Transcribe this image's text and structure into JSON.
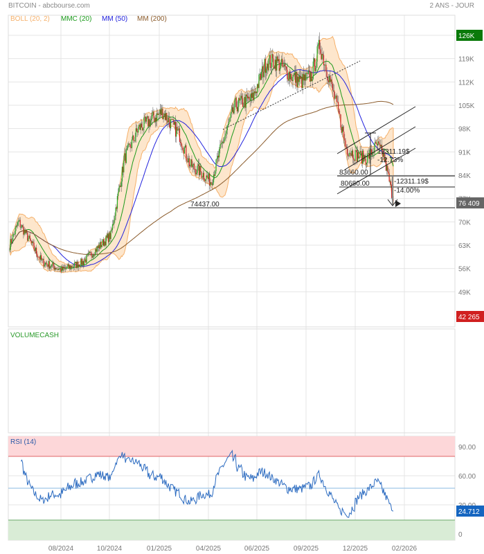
{
  "header": {
    "title": "BITCOIN - abcbourse.com",
    "period": "2 ANS - JOUR"
  },
  "legend": [
    {
      "label": "BOLL (20, 2)",
      "color": "#f5b06a"
    },
    {
      "label": "MMC (20)",
      "color": "#1a9a1a"
    },
    {
      "label": "MM (50)",
      "color": "#2222dd"
    },
    {
      "label": "MM (200)",
      "color": "#8a5a2a"
    }
  ],
  "price_tags": {
    "high": "126K",
    "last": "76 409",
    "low": "42 265",
    "rsi_last": "24.712"
  },
  "volume_label": "VOLUMECASH",
  "rsi_label": "RSI (14)",
  "annotations": {
    "support": "74437.00",
    "level1": "83660.00",
    "level2": "80680.00",
    "drop_value": "-12311.19$",
    "drop_pct": "-14.00%",
    "range_value": "12311.19$",
    "range_pct": "-12.73%"
  },
  "chart_data": {
    "type": "candlestick",
    "title": "BITCOIN",
    "x_ticks": [
      "08/2024",
      "10/2024",
      "01/2025",
      "04/2025",
      "06/2025",
      "09/2025",
      "12/2025",
      "02/2026"
    ],
    "y_ticks": [
      "126K",
      "119K",
      "112K",
      "105K",
      "98K",
      "91K",
      "84K",
      "77K",
      "70K",
      "63K",
      "56K",
      "49K"
    ],
    "y_tick_values": [
      126,
      119,
      112,
      105,
      98,
      91,
      84,
      77,
      70,
      63,
      56,
      49
    ],
    "ylim": [
      42,
      131
    ],
    "rsi_ticks": [
      "90.00",
      "60.00",
      "30.00",
      "0"
    ],
    "rsi_tick_values": [
      90,
      60,
      30,
      0
    ],
    "rsi_overbought": 80,
    "rsi_oversold": 15,
    "rsi_mid": 50,
    "n_days": 475,
    "close_path_k": [
      [
        0,
        63
      ],
      [
        11,
        70
      ],
      [
        40,
        58
      ],
      [
        65,
        55.5
      ],
      [
        91,
        58
      ],
      [
        125,
        66
      ],
      [
        142,
        89
      ],
      [
        159,
        98
      ],
      [
        189,
        103
      ],
      [
        210,
        96
      ],
      [
        223,
        87
      ],
      [
        236,
        85
      ],
      [
        249,
        82
      ],
      [
        262,
        93
      ],
      [
        279,
        105
      ],
      [
        300,
        107
      ],
      [
        317,
        118
      ],
      [
        330,
        118
      ],
      [
        347,
        114
      ],
      [
        360,
        112
      ],
      [
        373,
        114
      ],
      [
        383,
        123
      ],
      [
        394,
        114
      ],
      [
        407,
        102
      ],
      [
        416,
        92
      ],
      [
        428,
        90
      ],
      [
        441,
        89
      ],
      [
        454,
        93
      ],
      [
        462,
        90
      ],
      [
        471,
        80
      ],
      [
        474,
        76.4
      ]
    ]
  }
}
